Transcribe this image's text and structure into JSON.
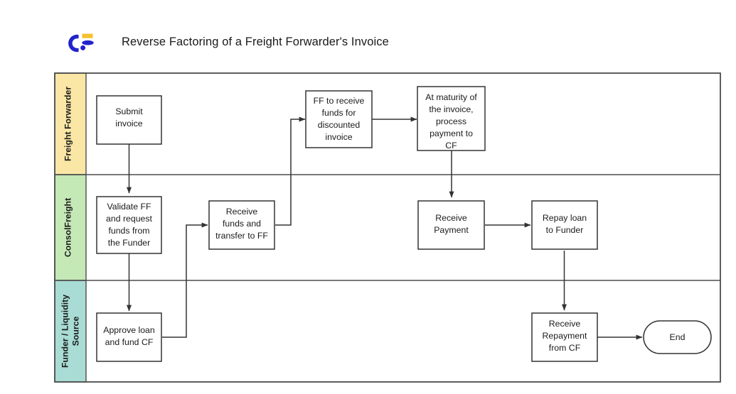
{
  "header": {
    "title": "Reverse Factoring of a Freight Forwarder's Invoice",
    "logo_name": "consolfreight-logo",
    "logo_colors": {
      "blue": "#2222cc",
      "yellow": "#f7c12e"
    }
  },
  "diagram": {
    "type": "swimlane-flowchart",
    "border_color": "#4d4d4d",
    "node_fill": "#ffffff",
    "node_stroke": "#333333",
    "connector_color": "#333333",
    "lanes": [
      {
        "id": "lane-freight-forwarder",
        "label": "Freight Forwarder",
        "color": "#fae7a6"
      },
      {
        "id": "lane-consolfreight",
        "label": "ConsolFreight",
        "color": "#c5e8b7"
      },
      {
        "id": "lane-funder",
        "label": "Funder / Liquidity Source",
        "color": "#a8dcd4"
      }
    ],
    "nodes": [
      {
        "id": "submit-invoice",
        "lane": 0,
        "shape": "rect",
        "lines": [
          "Submit",
          "invoice"
        ]
      },
      {
        "id": "ff-to-receive-funds",
        "lane": 0,
        "shape": "rect",
        "lines": [
          "FF to receive",
          "funds for",
          "discounted",
          "invoice"
        ]
      },
      {
        "id": "at-maturity-process-payment",
        "lane": 0,
        "shape": "rect",
        "lines": [
          "At maturity of",
          "the invoice,",
          "process",
          "payment to",
          "CF"
        ]
      },
      {
        "id": "validate-ff-request-funds",
        "lane": 1,
        "shape": "rect",
        "lines": [
          "Validate FF",
          "and request",
          "funds from",
          "the Funder"
        ]
      },
      {
        "id": "receive-funds-transfer-ff",
        "lane": 1,
        "shape": "rect",
        "lines": [
          "Receive",
          "funds and",
          "transfer to FF"
        ]
      },
      {
        "id": "receive-payment",
        "lane": 1,
        "shape": "rect",
        "lines": [
          "Receive",
          "Payment"
        ]
      },
      {
        "id": "repay-loan-to-funder",
        "lane": 1,
        "shape": "rect",
        "lines": [
          "Repay loan",
          "to Funder"
        ]
      },
      {
        "id": "approve-loan-fund-cf",
        "lane": 2,
        "shape": "rect",
        "lines": [
          "Approve loan",
          "and fund CF"
        ]
      },
      {
        "id": "receive-repayment-from-cf",
        "lane": 2,
        "shape": "rect",
        "lines": [
          "Receive",
          "Repayment",
          "from CF"
        ]
      },
      {
        "id": "end",
        "lane": 2,
        "shape": "terminator",
        "lines": [
          "End"
        ]
      }
    ],
    "edges": [
      {
        "from": "submit-invoice",
        "to": "validate-ff-request-funds"
      },
      {
        "from": "validate-ff-request-funds",
        "to": "approve-loan-fund-cf"
      },
      {
        "from": "approve-loan-fund-cf",
        "to": "receive-funds-transfer-ff"
      },
      {
        "from": "receive-funds-transfer-ff",
        "to": "ff-to-receive-funds"
      },
      {
        "from": "ff-to-receive-funds",
        "to": "at-maturity-process-payment"
      },
      {
        "from": "at-maturity-process-payment",
        "to": "receive-payment"
      },
      {
        "from": "receive-payment",
        "to": "repay-loan-to-funder"
      },
      {
        "from": "repay-loan-to-funder",
        "to": "receive-repayment-from-cf"
      },
      {
        "from": "receive-repayment-from-cf",
        "to": "end"
      }
    ]
  },
  "labels": {
    "n0l0": "Submit",
    "n0l1": "invoice",
    "n1l0": "FF to receive",
    "n1l1": "funds for",
    "n1l2": "discounted",
    "n1l3": "invoice",
    "n2l0": "At maturity of",
    "n2l1": "the invoice,",
    "n2l2": "process",
    "n2l3": "payment to",
    "n2l4": "CF",
    "n3l0": "Validate FF",
    "n3l1": "and request",
    "n3l2": "funds from",
    "n3l3": "the Funder",
    "n4l0": "Receive",
    "n4l1": "funds and",
    "n4l2": "transfer to FF",
    "n5l0": "Receive",
    "n5l1": "Payment",
    "n6l0": "Repay loan",
    "n6l1": "to Funder",
    "n7l0": "Approve loan",
    "n7l1": "and fund CF",
    "n8l0": "Receive",
    "n8l1": "Repayment",
    "n8l2": "from CF",
    "n9l0": "End",
    "lane0": "Freight Forwarder",
    "lane1": "ConsolFreight",
    "lane2a": "Funder / Liquidity",
    "lane2b": "Source"
  }
}
